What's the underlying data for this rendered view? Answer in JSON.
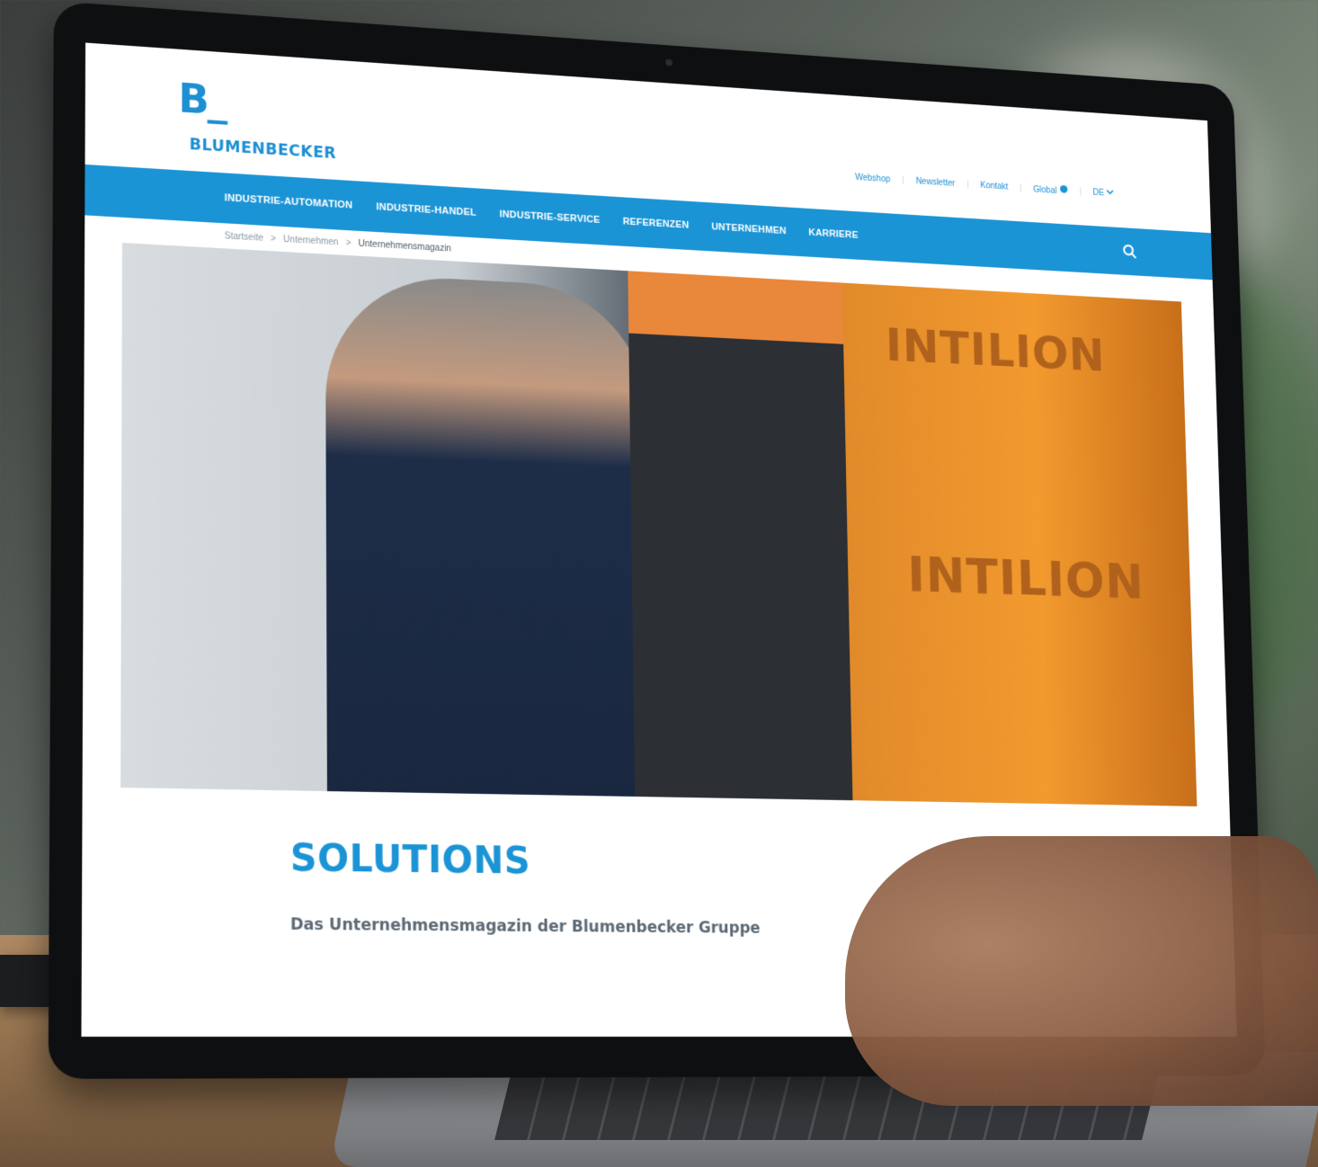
{
  "site": {
    "logo_mark": "B_",
    "logo_text": "BLUMENBECKER"
  },
  "top_links": [
    "Webshop",
    "Newsletter",
    "Kontakt",
    "Global",
    "DE"
  ],
  "nav": {
    "items": [
      "INDUSTRIE-AUTOMATION",
      "INDUSTRIE-HANDEL",
      "INDUSTRIE-SERVICE",
      "REFERENZEN",
      "UNTERNEHMEN",
      "KARRIERE"
    ]
  },
  "breadcrumb": {
    "items": [
      "Startseite",
      "Unternehmen",
      "Unternehmensmagazin"
    ]
  },
  "hero": {
    "labels": [
      "INTILION",
      "INTILION"
    ]
  },
  "content": {
    "headline": "SOLUTIONS",
    "subline": "Das Unternehmensmagazin der Blumenbecker Gruppe"
  },
  "colors": {
    "brand_blue": "#1b94d6",
    "text_gray": "#5d6a75"
  }
}
